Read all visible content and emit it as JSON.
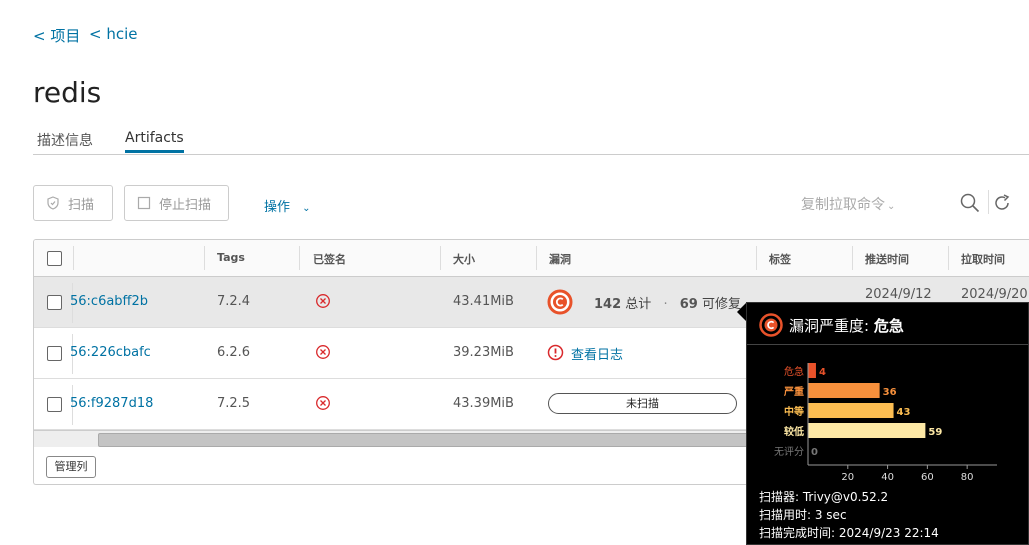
{
  "breadcrumb": {
    "projects": "< 项目",
    "project": "< hcie"
  },
  "page_title": "redis",
  "tabs": {
    "info": "描述信息",
    "artifacts": "Artifacts"
  },
  "toolbar": {
    "scan": "扫描",
    "stop_scan": "停止扫描",
    "actions": "操作",
    "copy_pull": "复制拉取命令"
  },
  "table": {
    "headers": {
      "tags": "Tags",
      "signed": "已签名",
      "size": "大小",
      "vulnerability": "漏洞",
      "labels": "标签",
      "push_time": "推送时间",
      "pull_time": "拉取时间"
    },
    "rows": [
      {
        "digest": "56:c6abff2b",
        "tag": "7.2.4",
        "size": "43.41MiB",
        "vuln_total_num": "142",
        "vuln_total_label": "总计",
        "vuln_dot": "·",
        "vuln_fix_num": "69",
        "vuln_fix_label": "可修复",
        "push_time": "2024/9/12",
        "pull_time": "2024/9/20"
      },
      {
        "digest": "56:226cbafc",
        "tag": "6.2.6",
        "size": "39.23MiB",
        "vuln_log": "查看日志"
      },
      {
        "digest": "56:f9287d18",
        "tag": "7.2.5",
        "size": "43.39MiB",
        "vuln_status": "未扫描"
      }
    ],
    "manage_columns": "管理列"
  },
  "tooltip": {
    "severity_label": "漏洞严重度:",
    "severity_value": "危急",
    "scanner": "扫描器: Trivy@v0.52.2",
    "duration": "扫描用时: 3 sec",
    "completed": "扫描完成时间: 2024/9/23 22:14"
  },
  "chart_data": {
    "type": "bar",
    "orientation": "horizontal",
    "categories": [
      "危急",
      "严重",
      "中等",
      "较低",
      "无评分"
    ],
    "values": [
      4,
      36,
      43,
      59,
      0
    ],
    "colors": [
      "#e8522a",
      "#f7903c",
      "#fbbd52",
      "#fde8a5",
      "#777777"
    ],
    "xticks": [
      20,
      40,
      60,
      80
    ],
    "xlim": [
      0,
      95
    ]
  },
  "colors": {
    "link": "#0072a3",
    "critical": "#e8522a",
    "signed_no": "#d9292c"
  }
}
